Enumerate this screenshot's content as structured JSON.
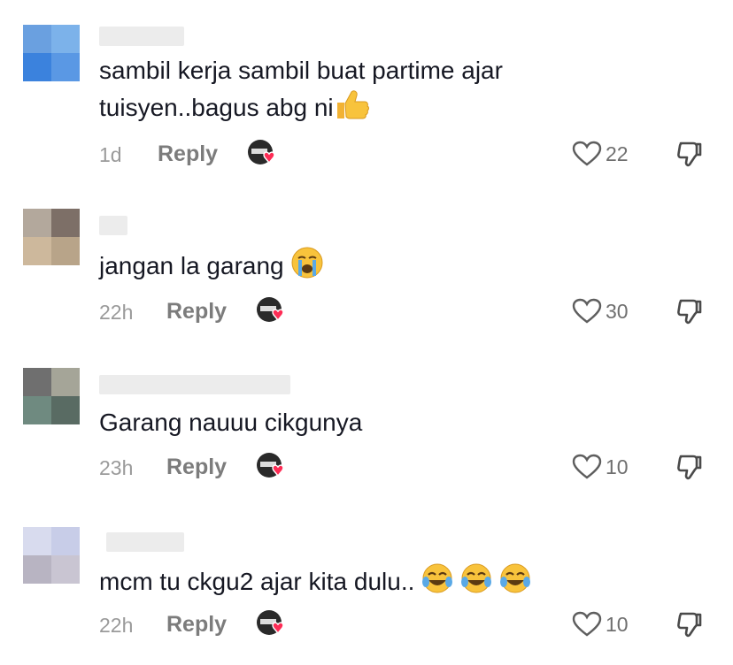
{
  "comments": [
    {
      "text": "sambil kerja sambil buat partime ajar tuisyen..bagus abg ni",
      "line1": "sambil kerja sambil buat partime ajar",
      "line2": "tuisyen..bagus abg ni",
      "time": "1d",
      "reply_label": "Reply",
      "likes": "22",
      "emoji": [
        "thumbs-up"
      ],
      "avatar_colors": [
        "#6aa0e0",
        "#7cb2ea",
        "#3b82dd",
        "#5a98e4"
      ]
    },
    {
      "text": "jangan la garang",
      "time": "22h",
      "reply_label": "Reply",
      "likes": "30",
      "emoji": [
        "loudly-crying-face"
      ],
      "avatar_colors": [
        "#b3a89c",
        "#7d6f67",
        "#cdb89c",
        "#b8a489"
      ]
    },
    {
      "text": "Garang nauuu cikgunya",
      "time": "23h",
      "reply_label": "Reply",
      "likes": "10",
      "emoji": [],
      "avatar_colors": [
        "#6f6f6f",
        "#a5a598",
        "#6f8a80",
        "#596b63"
      ]
    },
    {
      "text": "mcm tu ckgu2 ajar kita dulu..",
      "time": "22h",
      "reply_label": "Reply",
      "likes": "10",
      "emoji": [
        "face-with-tears-of-joy",
        "face-with-tears-of-joy",
        "face-with-tears-of-joy"
      ],
      "avatar_colors": [
        "#d8dbee",
        "#c8cde8",
        "#b8b4c2",
        "#c9c5d2"
      ]
    }
  ],
  "colors": {
    "text": "#161823",
    "meta": "#9a9a9a",
    "heart_pink": "#fe2c55"
  }
}
